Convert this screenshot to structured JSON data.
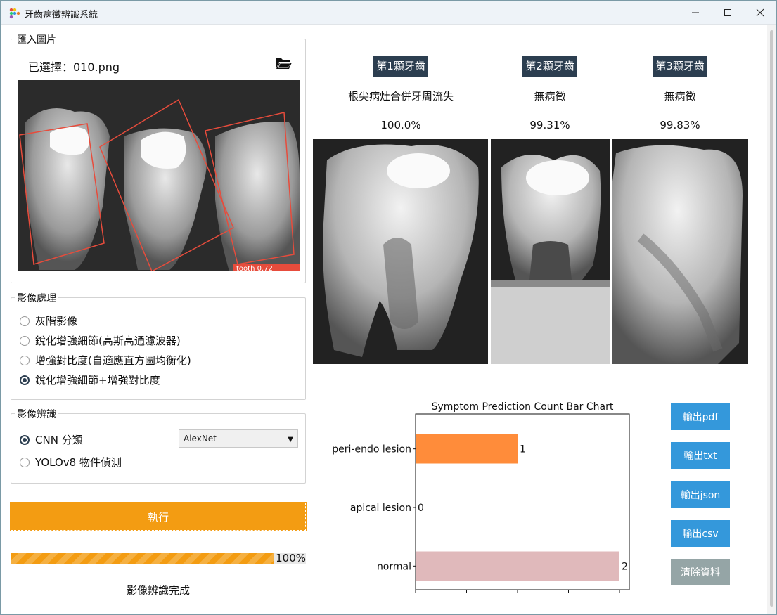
{
  "window": {
    "title": "牙齒病徵辨識系統",
    "controls": [
      "minimize-icon",
      "maximize-icon",
      "close-icon"
    ]
  },
  "import_group": {
    "label": "匯入圖片",
    "selected_file": "已選擇：010.png",
    "xray_overlay_label": "tooth  0.72"
  },
  "processing_group": {
    "label": "影像處理",
    "options": [
      {
        "label": "灰階影像",
        "checked": false
      },
      {
        "label": "銳化增強細節(高斯高通濾波器)",
        "checked": false
      },
      {
        "label": "增強對比度(自適應直方圖均衡化)",
        "checked": false
      },
      {
        "label": "銳化增強細節+增強對比度",
        "checked": true
      }
    ]
  },
  "recognition_group": {
    "label": "影像辨識",
    "options": [
      {
        "label": "CNN 分類",
        "checked": true
      },
      {
        "label": "YOLOv8 物件偵測",
        "checked": false
      }
    ],
    "model_select": "AlexNet"
  },
  "run_button": "執行",
  "progress": {
    "value": 100,
    "label": "100%"
  },
  "status": "影像辨識完成",
  "teeth": [
    {
      "tag": "第1顆牙齒",
      "diagnosis": "根尖病灶合併牙周流失",
      "confidence": "100.0%"
    },
    {
      "tag": "第2顆牙齒",
      "diagnosis": "無病徵",
      "confidence": "99.31%"
    },
    {
      "tag": "第3顆牙齒",
      "diagnosis": "無病徵",
      "confidence": "99.83%"
    }
  ],
  "export_buttons": {
    "pdf": "輸出pdf",
    "txt": "輸出txt",
    "json": "輸出json",
    "csv": "輸出csv",
    "clear": "清除資料"
  },
  "colors": {
    "accent_orange": "#f39c12",
    "export_blue": "#3498db",
    "clear_gray": "#95a5a6",
    "tag_dark": "#2c3e50",
    "bar_orange": "#ff8c3a",
    "bar_pink": "#e0b9bb"
  },
  "chart_data": {
    "type": "bar",
    "orientation": "horizontal",
    "title": "Symptom Prediction Count Bar Chart",
    "categories": [
      "peri-endo lesion",
      "apical lesion",
      "normal"
    ],
    "values": [
      1,
      0,
      2
    ],
    "value_labels": [
      "1",
      "0",
      "2"
    ],
    "xlim": [
      0,
      2.0
    ],
    "xticks": [
      "0.0",
      "0.5",
      "1.0",
      "1.5",
      "2.0"
    ],
    "bar_colors": [
      "#ff8c3a",
      "#ff8c3a",
      "#e0b9bb"
    ],
    "grid": false
  }
}
